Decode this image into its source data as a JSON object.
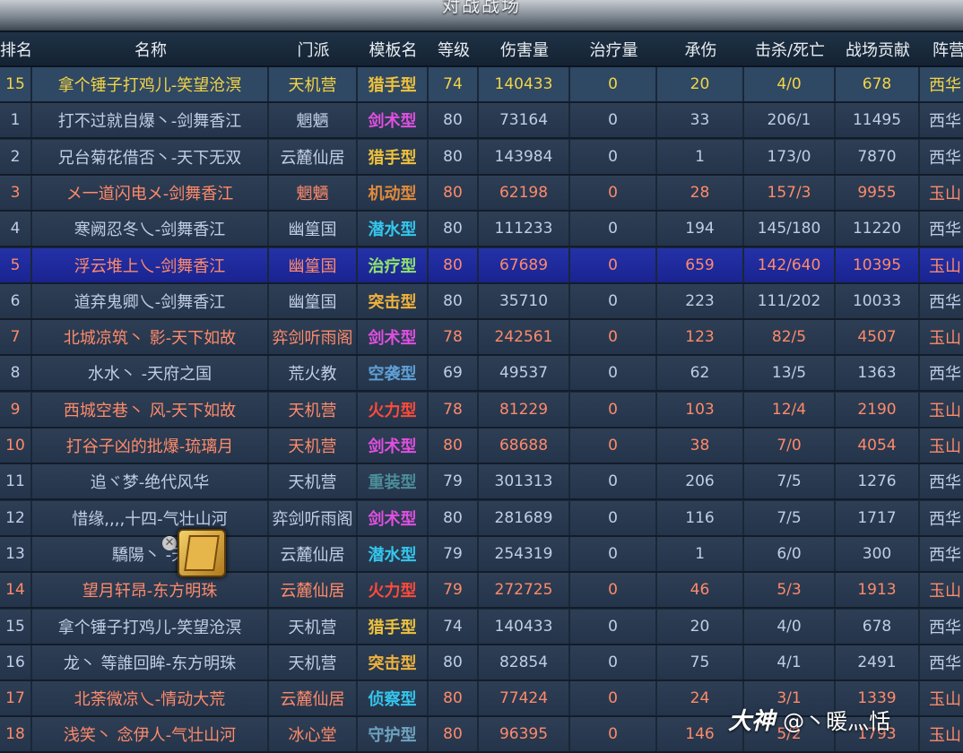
{
  "window": {
    "title": "对战战场"
  },
  "columns": [
    "排名",
    "名称",
    "门派",
    "模板名",
    "等级",
    "伤害量",
    "治疗量",
    "承伤",
    "击杀/死亡",
    "战场贡献",
    "阵营"
  ],
  "rows": [
    {
      "rank": "15",
      "name": "拿个锤子打鸡儿-笑望沧溟",
      "sect": "天机营",
      "template": "猎手型",
      "tpl": "hunter",
      "level": "74",
      "damage": "140433",
      "heal": "0",
      "taken": "20",
      "kd": "4/0",
      "contrib": "678",
      "faction": "西华",
      "style": "gold",
      "row": "player"
    },
    {
      "rank": "1",
      "name": "打不过就自爆丶-剑舞香江",
      "sect": "魍魉",
      "template": "剑术型",
      "tpl": "sword",
      "level": "80",
      "damage": "73164",
      "heal": "0",
      "taken": "33",
      "kd": "206/1",
      "contrib": "11495",
      "faction": "西华",
      "style": "blue"
    },
    {
      "rank": "2",
      "name": "兄台菊花借否丶-天下无双",
      "sect": "云麓仙居",
      "template": "猎手型",
      "tpl": "hunter",
      "level": "80",
      "damage": "143984",
      "heal": "0",
      "taken": "1",
      "kd": "173/0",
      "contrib": "7870",
      "faction": "西华",
      "style": "blue"
    },
    {
      "rank": "3",
      "name": "メ一道闪电メ-剑舞香江",
      "sect": "魍魉",
      "template": "机动型",
      "tpl": "mobile",
      "level": "80",
      "damage": "62198",
      "heal": "0",
      "taken": "28",
      "kd": "157/3",
      "contrib": "9955",
      "faction": "玉山",
      "style": "red"
    },
    {
      "rank": "4",
      "name": "寒阙忍冬乀-剑舞香江",
      "sect": "幽篁国",
      "template": "潜水型",
      "tpl": "dive",
      "level": "80",
      "damage": "111233",
      "heal": "0",
      "taken": "194",
      "kd": "145/180",
      "contrib": "11220",
      "faction": "西华",
      "style": "blue"
    },
    {
      "rank": "5",
      "name": "浮云堆上乀-剑舞香江",
      "sect": "幽篁国",
      "template": "治疗型",
      "tpl": "heal",
      "level": "80",
      "damage": "67689",
      "heal": "0",
      "taken": "659",
      "kd": "142/640",
      "contrib": "10395",
      "faction": "玉山",
      "style": "red",
      "row": "self"
    },
    {
      "rank": "6",
      "name": "道弃鬼卿乀-剑舞香江",
      "sect": "幽篁国",
      "template": "突击型",
      "tpl": "assault",
      "level": "80",
      "damage": "35710",
      "heal": "0",
      "taken": "223",
      "kd": "111/202",
      "contrib": "10033",
      "faction": "西华",
      "style": "blue"
    },
    {
      "rank": "7",
      "name": "北城凉筑丶 影-天下如故",
      "sect": "弈剑听雨阁",
      "template": "剑术型",
      "tpl": "sword",
      "level": "78",
      "damage": "242561",
      "heal": "0",
      "taken": "123",
      "kd": "82/5",
      "contrib": "4507",
      "faction": "玉山",
      "style": "red"
    },
    {
      "rank": "8",
      "name": "水水丶 -天府之国",
      "sect": "荒火教",
      "template": "空袭型",
      "tpl": "air",
      "level": "69",
      "damage": "49537",
      "heal": "0",
      "taken": "62",
      "kd": "13/5",
      "contrib": "1363",
      "faction": "西华",
      "style": "blue"
    },
    {
      "rank": "9",
      "name": "西城空巷丶 风-天下如故",
      "sect": "天机营",
      "template": "火力型",
      "tpl": "fire",
      "level": "78",
      "damage": "81229",
      "heal": "0",
      "taken": "103",
      "kd": "12/4",
      "contrib": "2190",
      "faction": "玉山",
      "style": "red"
    },
    {
      "rank": "10",
      "name": "打谷子凶的批爆-琉璃月",
      "sect": "天机营",
      "template": "剑术型",
      "tpl": "sword",
      "level": "80",
      "damage": "68688",
      "heal": "0",
      "taken": "38",
      "kd": "7/0",
      "contrib": "4054",
      "faction": "玉山",
      "style": "red"
    },
    {
      "rank": "11",
      "name": "追ヾ梦-绝代风华",
      "sect": "天机营",
      "template": "重装型",
      "tpl": "heavy",
      "level": "79",
      "damage": "301313",
      "heal": "0",
      "taken": "206",
      "kd": "7/5",
      "contrib": "1276",
      "faction": "西华",
      "style": "blue"
    },
    {
      "rank": "12",
      "name": "惜缘,,,,十四-气壮山河",
      "sect": "弈剑听雨阁",
      "template": "剑术型",
      "tpl": "sword",
      "level": "80",
      "damage": "281689",
      "heal": "0",
      "taken": "116",
      "kd": "7/5",
      "contrib": "1717",
      "faction": "西华",
      "style": "blue"
    },
    {
      "rank": "13",
      "name": "驕陽丶 -天",
      "sect": "云麓仙居",
      "template": "潜水型",
      "tpl": "dive",
      "level": "79",
      "damage": "254319",
      "heal": "0",
      "taken": "1",
      "kd": "6/0",
      "contrib": "300",
      "faction": "西华",
      "style": "blue"
    },
    {
      "rank": "14",
      "name": "望月轩昂-东方明珠",
      "sect": "云麓仙居",
      "template": "火力型",
      "tpl": "fire",
      "level": "79",
      "damage": "272725",
      "heal": "0",
      "taken": "46",
      "kd": "5/3",
      "contrib": "1913",
      "faction": "玉山",
      "style": "red"
    },
    {
      "rank": "15",
      "name": "拿个锤子打鸡儿-笑望沧溟",
      "sect": "天机营",
      "template": "猎手型",
      "tpl": "hunter",
      "level": "74",
      "damage": "140433",
      "heal": "0",
      "taken": "20",
      "kd": "4/0",
      "contrib": "678",
      "faction": "西华",
      "style": "blue"
    },
    {
      "rank": "16",
      "name": "龙丶 等誰回眸-东方明珠",
      "sect": "天机营",
      "template": "突击型",
      "tpl": "assault",
      "level": "80",
      "damage": "82854",
      "heal": "0",
      "taken": "75",
      "kd": "4/1",
      "contrib": "2491",
      "faction": "西华",
      "style": "blue"
    },
    {
      "rank": "17",
      "name": "北荼微凉乀-情动大荒",
      "sect": "云麓仙居",
      "template": "侦察型",
      "tpl": "scout",
      "level": "80",
      "damage": "77424",
      "heal": "0",
      "taken": "24",
      "kd": "3/1",
      "contrib": "1339",
      "faction": "玉山",
      "style": "red"
    },
    {
      "rank": "18",
      "name": "浅笑丶 念伊人-气壮山河",
      "sect": "冰心堂",
      "template": "守护型",
      "tpl": "guard",
      "level": "80",
      "damage": "96395",
      "heal": "0",
      "taken": "146",
      "kd": "5/2",
      "contrib": "1793",
      "faction": "玉山",
      "style": "red"
    }
  ],
  "icons": {
    "item": "scroll-item-icon",
    "close": "close-icon"
  },
  "watermark": {
    "logo": "大神",
    "user": "@丶暖灬恬"
  }
}
